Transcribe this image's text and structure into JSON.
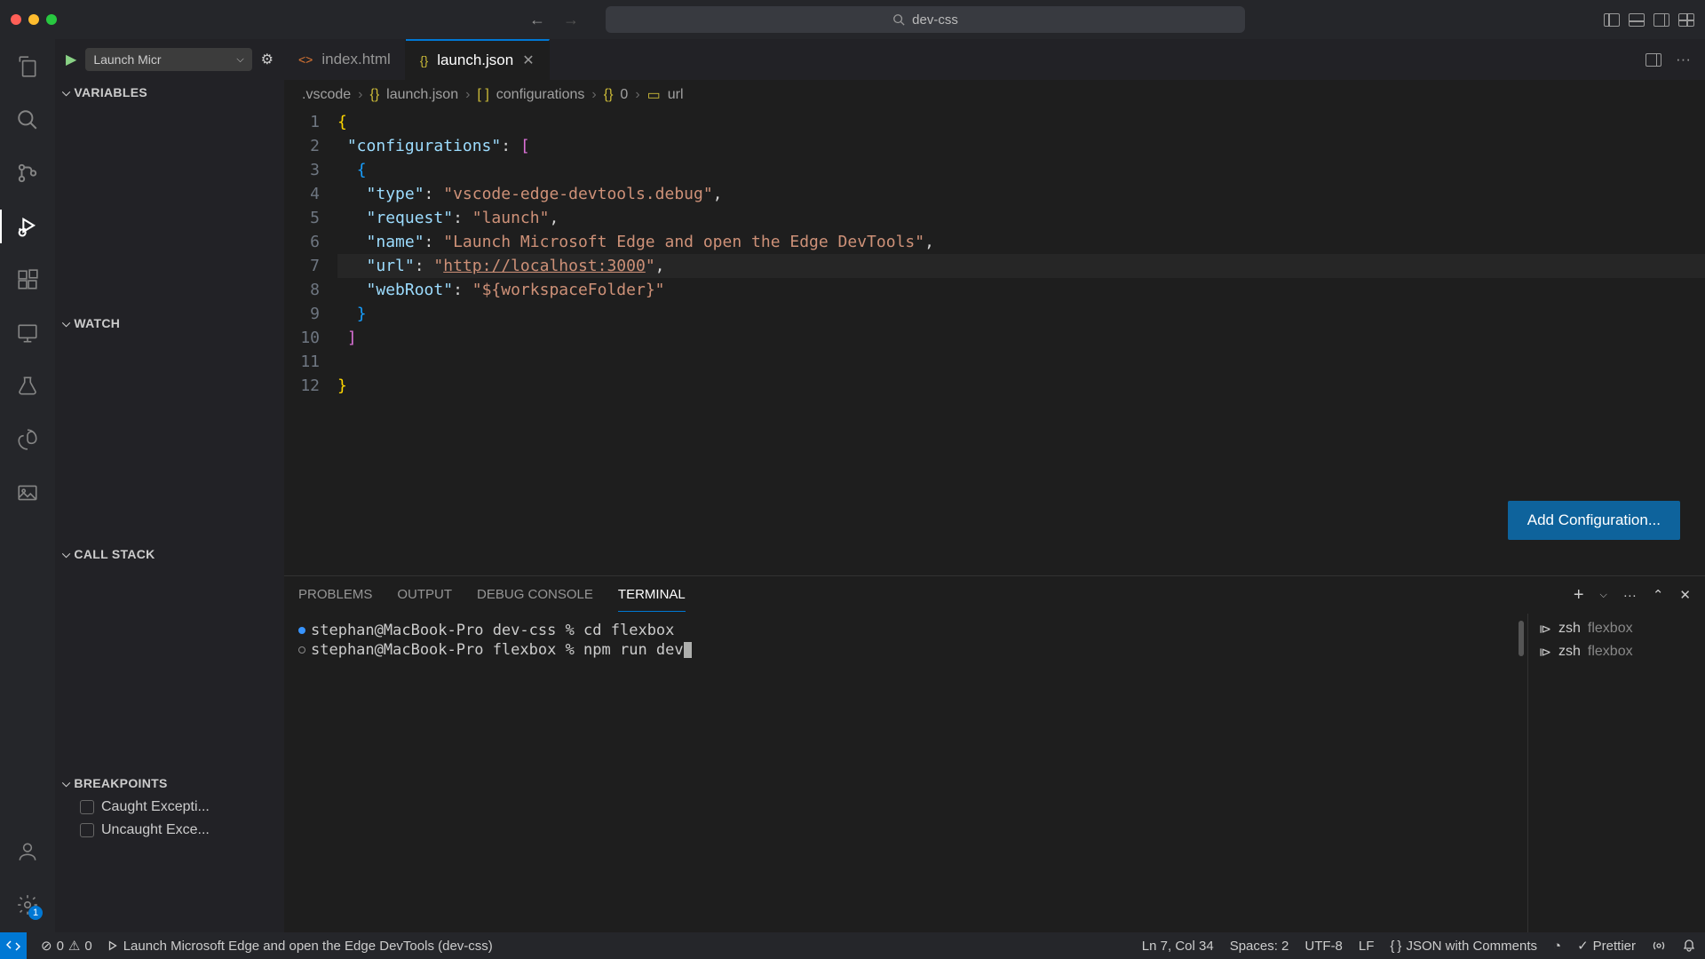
{
  "titlebar": {
    "search_text": "dev-css"
  },
  "run_config": {
    "selected_label": "Launch Micr"
  },
  "sidebar": {
    "variables_label": "VARIABLES",
    "watch_label": "WATCH",
    "callstack_label": "CALL STACK",
    "breakpoints_label": "BREAKPOINTS",
    "breakpoints": [
      "Caught Excepti...",
      "Uncaught Exce..."
    ]
  },
  "tabs": [
    {
      "filename": "index.html",
      "icon": "html",
      "active": false
    },
    {
      "filename": "launch.json",
      "icon": "json",
      "active": true
    }
  ],
  "breadcrumbs": {
    "folder": ".vscode",
    "file": "launch.json",
    "path1": "configurations",
    "path2": "0",
    "path3": "url"
  },
  "code_lines": [
    {
      "n": 1,
      "html": "<span class='b'>{</span>"
    },
    {
      "n": 2,
      "html": " <span class='k'>\"configurations\"</span><span class='p'>:</span> <span class='b2'>[</span>"
    },
    {
      "n": 3,
      "html": "  <span class='b3'>{</span>"
    },
    {
      "n": 4,
      "html": "   <span class='k'>\"type\"</span><span class='p'>:</span> <span class='s'>\"vscode-edge-devtools.debug\"</span><span class='p'>,</span>"
    },
    {
      "n": 5,
      "html": "   <span class='k'>\"request\"</span><span class='p'>:</span> <span class='s'>\"launch\"</span><span class='p'>,</span>"
    },
    {
      "n": 6,
      "html": "   <span class='k'>\"name\"</span><span class='p'>:</span> <span class='s'>\"Launch Microsoft Edge and open the Edge DevTools\"</span><span class='p'>,</span>"
    },
    {
      "n": 7,
      "html": "   <span class='k'>\"url\"</span><span class='p'>:</span> <span class='s'>\"<span class='url'>http://localhost:3000</span>\"</span><span class='p'>,</span>",
      "current": true
    },
    {
      "n": 8,
      "html": "   <span class='k'>\"webRoot\"</span><span class='p'>:</span> <span class='s'>\"${workspaceFolder}\"</span>"
    },
    {
      "n": 9,
      "html": "  <span class='b3'>}</span>"
    },
    {
      "n": 10,
      "html": " <span class='b2'>]</span>"
    },
    {
      "n": 11,
      "html": ""
    },
    {
      "n": 12,
      "html": "<span class='b'>}</span>"
    }
  ],
  "add_config_label": "Add Configuration...",
  "panel": {
    "tabs": [
      "PROBLEMS",
      "OUTPUT",
      "DEBUG CONSOLE",
      "TERMINAL"
    ],
    "active_tab": "TERMINAL",
    "terminal_lines": [
      {
        "dot": "blue",
        "prompt": "stephan@MacBook-Pro dev-css % ",
        "cmd": "cd flexbox"
      },
      {
        "dot": "circle",
        "prompt": "stephan@MacBook-Pro flexbox % ",
        "cmd": "npm run dev",
        "cursor": true
      }
    ],
    "terminal_sessions": [
      {
        "shell": "zsh",
        "label": "flexbox"
      },
      {
        "shell": "zsh",
        "label": "flexbox"
      }
    ]
  },
  "statusbar": {
    "errors": "0",
    "warnings": "0",
    "debug_target": "Launch Microsoft Edge and open the Edge DevTools (dev-css)",
    "position": "Ln 7, Col 34",
    "spaces": "Spaces: 2",
    "encoding": "UTF-8",
    "eol": "LF",
    "language": "JSON with Comments",
    "prettier": "Prettier",
    "settings_badge": "1"
  }
}
